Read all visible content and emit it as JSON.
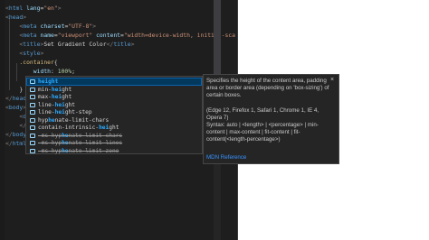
{
  "code_lines": [
    {
      "parts": [
        {
          "t": "<",
          "c": "brk"
        },
        {
          "t": "html ",
          "c": "tag"
        },
        {
          "t": "lang",
          "c": "attr"
        },
        {
          "t": "=",
          "c": ""
        },
        {
          "t": "\"en\"",
          "c": "str"
        },
        {
          "t": ">",
          "c": "brk"
        }
      ]
    },
    {
      "parts": [
        {
          "t": "<",
          "c": "brk"
        },
        {
          "t": "head",
          "c": "tag"
        },
        {
          "t": ">",
          "c": "brk"
        }
      ]
    },
    {
      "parts": [
        {
          "t": "    <",
          "c": "brk"
        },
        {
          "t": "meta ",
          "c": "tag"
        },
        {
          "t": "charset",
          "c": "attr"
        },
        {
          "t": "=",
          "c": ""
        },
        {
          "t": "\"UTF-8\"",
          "c": "str"
        },
        {
          "t": ">",
          "c": "brk"
        }
      ]
    },
    {
      "parts": [
        {
          "t": "    <",
          "c": "brk"
        },
        {
          "t": "meta ",
          "c": "tag"
        },
        {
          "t": "name",
          "c": "attr"
        },
        {
          "t": "=",
          "c": ""
        },
        {
          "t": "\"viewport\" ",
          "c": "str"
        },
        {
          "t": "content",
          "c": "attr"
        },
        {
          "t": "=",
          "c": ""
        },
        {
          "t": "\"width=device-width, initial-sca",
          "c": "str"
        }
      ]
    },
    {
      "parts": [
        {
          "t": "    <",
          "c": "brk"
        },
        {
          "t": "title",
          "c": "tag"
        },
        {
          "t": ">",
          "c": "brk"
        },
        {
          "t": "Set Gradient Color",
          "c": ""
        },
        {
          "t": "</",
          "c": "brk"
        },
        {
          "t": "title",
          "c": "tag"
        },
        {
          "t": ">",
          "c": "brk"
        }
      ]
    },
    {
      "parts": [
        {
          "t": "    <",
          "c": "brk"
        },
        {
          "t": "style",
          "c": "tag"
        },
        {
          "t": ">",
          "c": "brk"
        }
      ]
    },
    {
      "parts": [
        {
          "t": "    .container",
          "c": "sel"
        },
        {
          "t": "{",
          "c": ""
        }
      ]
    },
    {
      "parts": [
        {
          "t": "        width",
          "c": "prop"
        },
        {
          "t": ": ",
          "c": ""
        },
        {
          "t": "100%",
          "c": "num"
        },
        {
          "t": ";",
          "c": ""
        }
      ]
    },
    {
      "parts": [
        {
          "t": "        hei",
          "c": "prop"
        }
      ],
      "cursor": true
    },
    {
      "parts": [
        {
          "t": "    }",
          "c": ""
        }
      ]
    },
    {
      "parts": [
        {
          "t": "</",
          "c": "brk"
        },
        {
          "t": "head",
          "c": "tag"
        },
        {
          "t": ">",
          "c": "brk"
        }
      ]
    },
    {
      "parts": [
        {
          "t": "<",
          "c": "brk"
        },
        {
          "t": "body",
          "c": "tag"
        },
        {
          "t": ">",
          "c": "brk"
        }
      ]
    },
    {
      "parts": [
        {
          "t": "    <",
          "c": "brk"
        },
        {
          "t": "div ",
          "c": "tag"
        },
        {
          "t": "c",
          "c": "attr"
        }
      ]
    },
    {
      "parts": [
        {
          "t": "    </",
          "c": "brk"
        },
        {
          "t": "d",
          "c": "tag"
        }
      ]
    },
    {
      "parts": [
        {
          "t": "</",
          "c": "brk"
        },
        {
          "t": "body",
          "c": "tag"
        },
        {
          "t": ">",
          "c": "brk"
        }
      ]
    },
    {
      "parts": [
        {
          "t": "</",
          "c": "brk"
        },
        {
          "t": "html",
          "c": "tag"
        },
        {
          "t": ">",
          "c": "brk"
        }
      ]
    }
  ],
  "suggestions": [
    {
      "match": "height",
      "rest": "",
      "pre": "",
      "deprecated": false,
      "active": true
    },
    {
      "pre": "min-",
      "match": "hei",
      "rest": "ght",
      "deprecated": false,
      "active": false
    },
    {
      "pre": "max-",
      "match": "hei",
      "rest": "ght",
      "deprecated": false,
      "active": false
    },
    {
      "pre": "line-",
      "match": "hei",
      "rest": "ght",
      "deprecated": false,
      "active": false
    },
    {
      "pre": "line-",
      "match": "hei",
      "rest": "ght-step",
      "deprecated": false,
      "active": false
    },
    {
      "pre": "hyp",
      "match": "he",
      "rest": "nate-limit-chars",
      "deprecated": false,
      "active": false
    },
    {
      "pre": "contain-intrinsic-",
      "match": "hei",
      "rest": "ght",
      "deprecated": false,
      "active": false
    },
    {
      "pre": "-ms-hyp",
      "match": "he",
      "rest": "nate-limit-chars",
      "deprecated": true,
      "active": false
    },
    {
      "pre": "-ms-hyp",
      "match": "he",
      "rest": "nate-limit-lines",
      "deprecated": true,
      "active": false
    },
    {
      "pre": "-ms-hyp",
      "match": "he",
      "rest": "nate-limit-zone",
      "deprecated": true,
      "active": false
    }
  ],
  "docs": {
    "description": "Specifies the height of the content area, padding area or border area (depending on 'box-sizing') of certain boxes.",
    "browsers": "(Edge 12, Firefox 1, Safari 1, Chrome 1, IE 4, Opera 7)",
    "syntax": "Syntax: auto | <length> | <percentage> | min-content | max-content | fit-content | fit-content(<length-percentage>)",
    "link": "MDN Reference",
    "close": "×"
  }
}
